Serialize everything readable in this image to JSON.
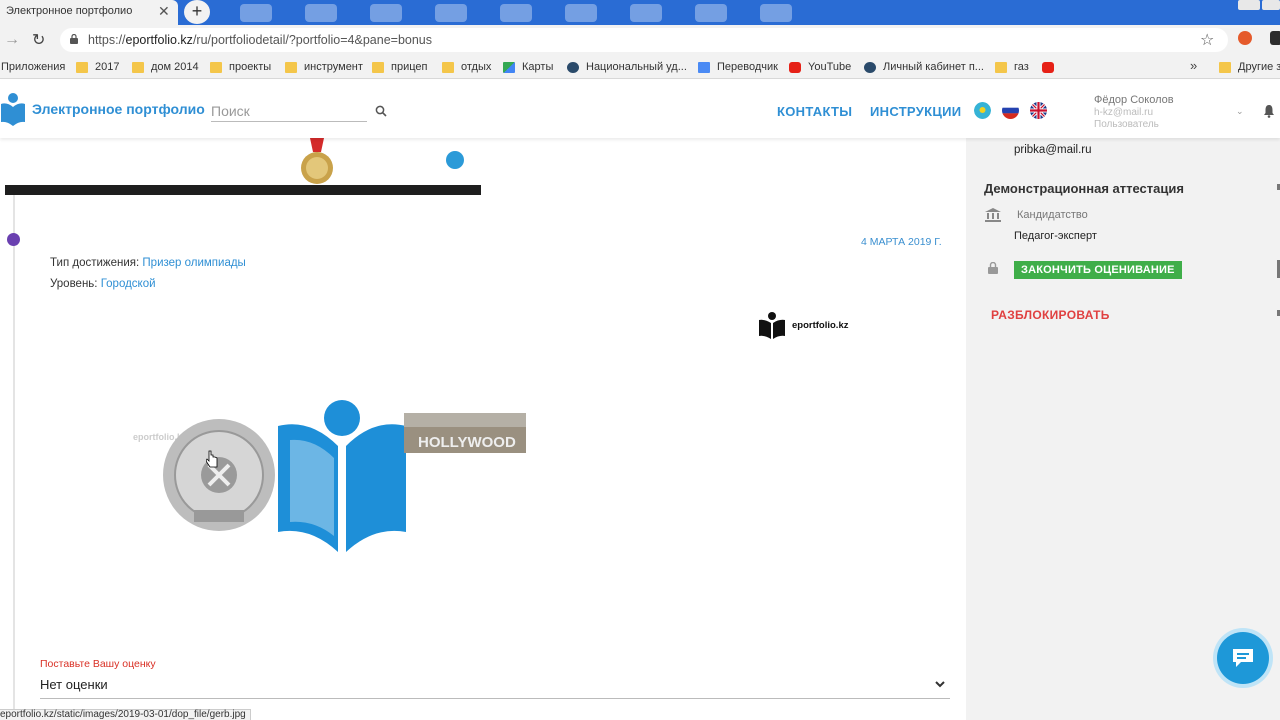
{
  "browser": {
    "tab_title": "Электронное портфолио",
    "tab_close": "✕",
    "new_tab": "+",
    "url_prefix": "https://",
    "url_host": "eportfolio.kz",
    "url_path": "/ru/portfoliodetail/?portfolio=4&pane=bonus",
    "bookmarks": [
      {
        "label": "Приложения",
        "icon": "apps-icon"
      },
      {
        "label": "2017",
        "icon": "folder-icon"
      },
      {
        "label": "дом 2014",
        "icon": "folder-icon"
      },
      {
        "label": "проекты",
        "icon": "folder-icon"
      },
      {
        "label": "инструмент",
        "icon": "folder-icon"
      },
      {
        "label": "прицеп",
        "icon": "folder-icon"
      },
      {
        "label": "отдых",
        "icon": "folder-icon"
      },
      {
        "label": "Карты",
        "icon": "maps-icon"
      },
      {
        "label": "Национальный уд...",
        "icon": "globe-icon"
      },
      {
        "label": "Переводчик",
        "icon": "translate-icon"
      },
      {
        "label": "YouTube",
        "icon": "youtube-icon"
      },
      {
        "label": "Личный кабинет п...",
        "icon": "globe-icon"
      },
      {
        "label": "газ",
        "icon": "folder-icon"
      },
      {
        "label": "",
        "icon": "youtube-icon"
      },
      {
        "label": "Другие з",
        "icon": "folder-icon"
      }
    ],
    "bookmarks_more": "»",
    "status_url": "eportfolio.kz/static/images/2019-03-01/dop_file/gerb.jpg"
  },
  "header": {
    "logo_text": "Электронное портфолио",
    "search_placeholder": "Поиск",
    "nav_contacts": "КОНТАКТЫ",
    "nav_instructions": "ИНСТРУКЦИИ",
    "languages": [
      "kz-flag-icon",
      "ru-flag-icon",
      "uk-flag-icon"
    ],
    "user_name": "Фёдор Соколов",
    "user_email": "h-kz@mail.ru",
    "user_role": "Пользователь"
  },
  "entry": {
    "date": "4 МАРТА 2019 Г.",
    "type_label": "Тип достижения: ",
    "type_value": "Призер олимпиады",
    "level_label": "Уровень: ",
    "level_value": "Городской",
    "watermark": "eportfolio.kz",
    "image_labels": {
      "faint_watermark": "eportfolio.kz",
      "hollywood": "HOLLYWOOD"
    }
  },
  "rating": {
    "label": "Поставьте Вашу оценку",
    "value": "Нет оценки"
  },
  "sidebar": {
    "email": "pribka@mail.ru",
    "title": "Демонстрационная аттестация",
    "category": "Кандидатство",
    "position": "Педагог-эксперт",
    "finish_button": "ЗАКОНЧИТЬ ОЦЕНИВАНИЕ",
    "unblock": "РАЗБЛОКИРОВАТЬ"
  },
  "colors": {
    "brand": "#2f8fd4",
    "tabstrip": "#2a6cd4",
    "finish_green": "#3fae49",
    "unblock_red": "#e04040",
    "timeline_dot": "#6a40b0"
  }
}
